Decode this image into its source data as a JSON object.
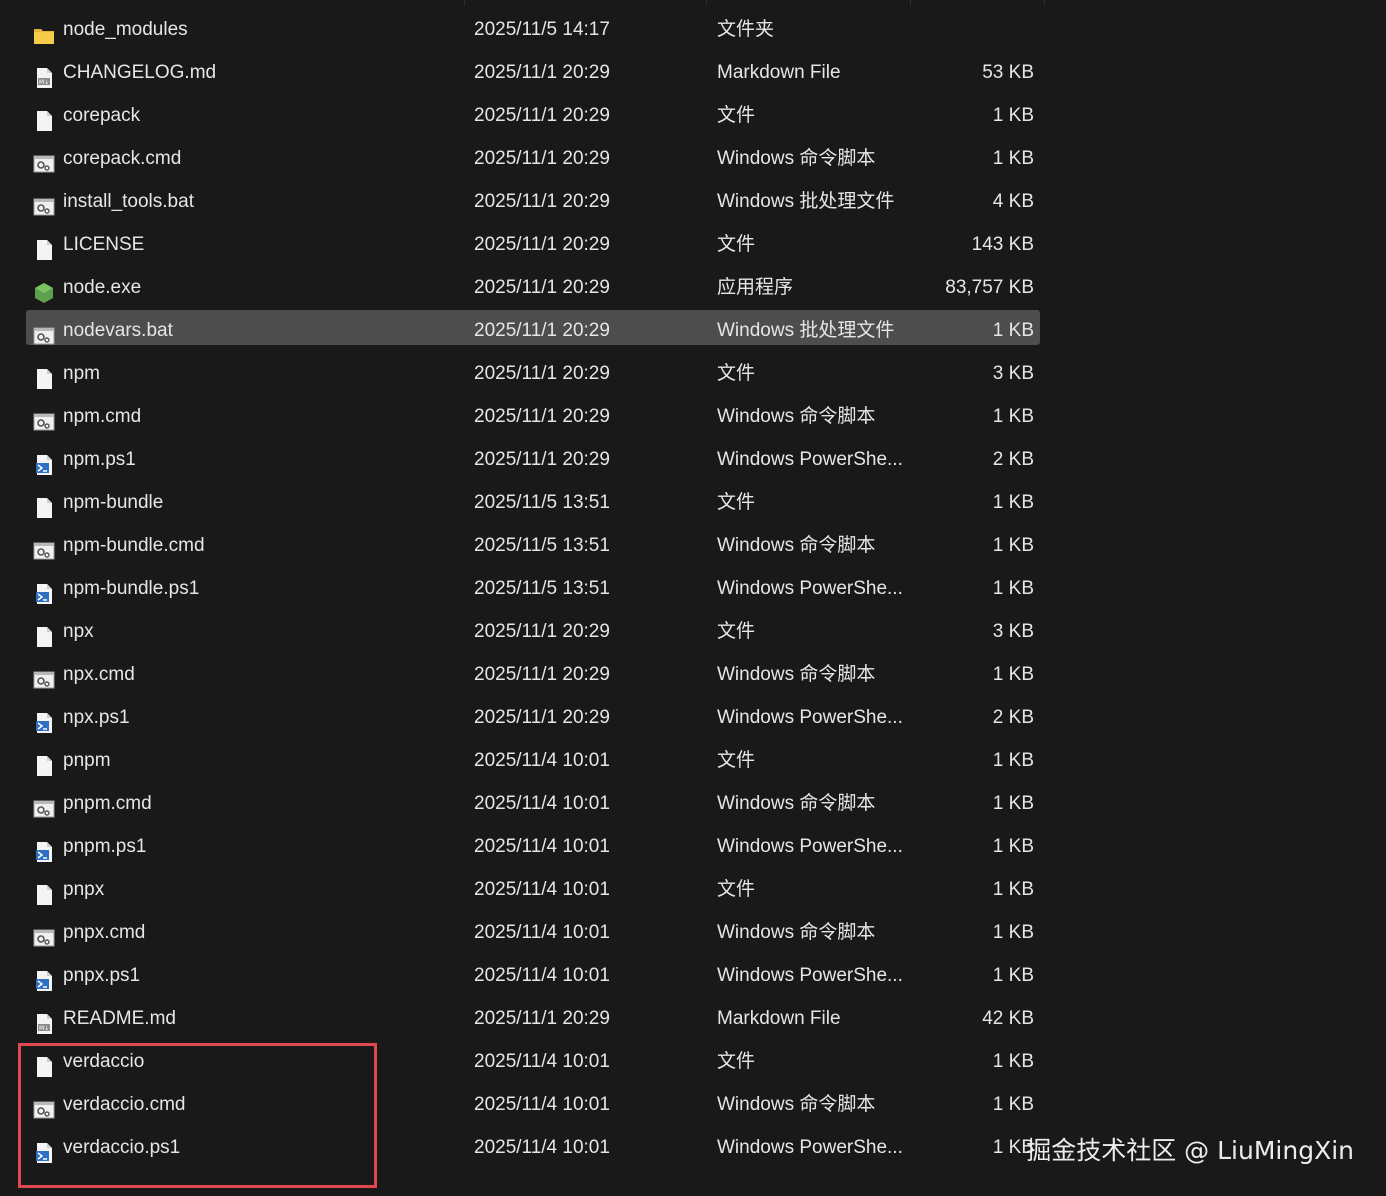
{
  "files": [
    {
      "name": "node_modules",
      "date": "2025/11/5 14:17",
      "type": "文件夹",
      "size": "",
      "icon": "folder-icon"
    },
    {
      "name": "CHANGELOG.md",
      "date": "2025/11/1 20:29",
      "type": "Markdown File",
      "size": "53 KB",
      "icon": "markdown-file-icon"
    },
    {
      "name": "corepack",
      "date": "2025/11/1 20:29",
      "type": "文件",
      "size": "1 KB",
      "icon": "file-icon"
    },
    {
      "name": "corepack.cmd",
      "date": "2025/11/1 20:29",
      "type": "Windows 命令脚本",
      "size": "1 KB",
      "icon": "script-file-icon"
    },
    {
      "name": "install_tools.bat",
      "date": "2025/11/1 20:29",
      "type": "Windows 批处理文件",
      "size": "4 KB",
      "icon": "script-file-icon"
    },
    {
      "name": "LICENSE",
      "date": "2025/11/1 20:29",
      "type": "文件",
      "size": "143 KB",
      "icon": "file-icon"
    },
    {
      "name": "node.exe",
      "date": "2025/11/1 20:29",
      "type": "应用程序",
      "size": "83,757 KB",
      "icon": "nodejs-icon"
    },
    {
      "name": "nodevars.bat",
      "date": "2025/11/1 20:29",
      "type": "Windows 批处理文件",
      "size": "1 KB",
      "icon": "script-file-icon",
      "selected": true
    },
    {
      "name": "npm",
      "date": "2025/11/1 20:29",
      "type": "文件",
      "size": "3 KB",
      "icon": "file-icon"
    },
    {
      "name": "npm.cmd",
      "date": "2025/11/1 20:29",
      "type": "Windows 命令脚本",
      "size": "1 KB",
      "icon": "script-file-icon"
    },
    {
      "name": "npm.ps1",
      "date": "2025/11/1 20:29",
      "type": "Windows PowerShe...",
      "size": "2 KB",
      "icon": "powershell-file-icon"
    },
    {
      "name": "npm-bundle",
      "date": "2025/11/5 13:51",
      "type": "文件",
      "size": "1 KB",
      "icon": "file-icon"
    },
    {
      "name": "npm-bundle.cmd",
      "date": "2025/11/5 13:51",
      "type": "Windows 命令脚本",
      "size": "1 KB",
      "icon": "script-file-icon"
    },
    {
      "name": "npm-bundle.ps1",
      "date": "2025/11/5 13:51",
      "type": "Windows PowerShe...",
      "size": "1 KB",
      "icon": "powershell-file-icon"
    },
    {
      "name": "npx",
      "date": "2025/11/1 20:29",
      "type": "文件",
      "size": "3 KB",
      "icon": "file-icon"
    },
    {
      "name": "npx.cmd",
      "date": "2025/11/1 20:29",
      "type": "Windows 命令脚本",
      "size": "1 KB",
      "icon": "script-file-icon"
    },
    {
      "name": "npx.ps1",
      "date": "2025/11/1 20:29",
      "type": "Windows PowerShe...",
      "size": "2 KB",
      "icon": "powershell-file-icon"
    },
    {
      "name": "pnpm",
      "date": "2025/11/4 10:01",
      "type": "文件",
      "size": "1 KB",
      "icon": "file-icon"
    },
    {
      "name": "pnpm.cmd",
      "date": "2025/11/4 10:01",
      "type": "Windows 命令脚本",
      "size": "1 KB",
      "icon": "script-file-icon"
    },
    {
      "name": "pnpm.ps1",
      "date": "2025/11/4 10:01",
      "type": "Windows PowerShe...",
      "size": "1 KB",
      "icon": "powershell-file-icon"
    },
    {
      "name": "pnpx",
      "date": "2025/11/4 10:01",
      "type": "文件",
      "size": "1 KB",
      "icon": "file-icon"
    },
    {
      "name": "pnpx.cmd",
      "date": "2025/11/4 10:01",
      "type": "Windows 命令脚本",
      "size": "1 KB",
      "icon": "script-file-icon"
    },
    {
      "name": "pnpx.ps1",
      "date": "2025/11/4 10:01",
      "type": "Windows PowerShe...",
      "size": "1 KB",
      "icon": "powershell-file-icon"
    },
    {
      "name": "README.md",
      "date": "2025/11/1 20:29",
      "type": "Markdown File",
      "size": "42 KB",
      "icon": "markdown-file-icon"
    },
    {
      "name": "verdaccio",
      "date": "2025/11/4 10:01",
      "type": "文件",
      "size": "1 KB",
      "icon": "file-icon"
    },
    {
      "name": "verdaccio.cmd",
      "date": "2025/11/4 10:01",
      "type": "Windows 命令脚本",
      "size": "1 KB",
      "icon": "script-file-icon"
    },
    {
      "name": "verdaccio.ps1",
      "date": "2025/11/4 10:01",
      "type": "Windows PowerShe...",
      "size": "1 KB",
      "icon": "powershell-file-icon"
    }
  ],
  "watermark": "掘金技术社区 @ LiuMingXin",
  "colors": {
    "background": "#191919",
    "selected_row": "#4d4d4d",
    "highlight_border": "#e0484f",
    "text": "#e6e6e6"
  }
}
